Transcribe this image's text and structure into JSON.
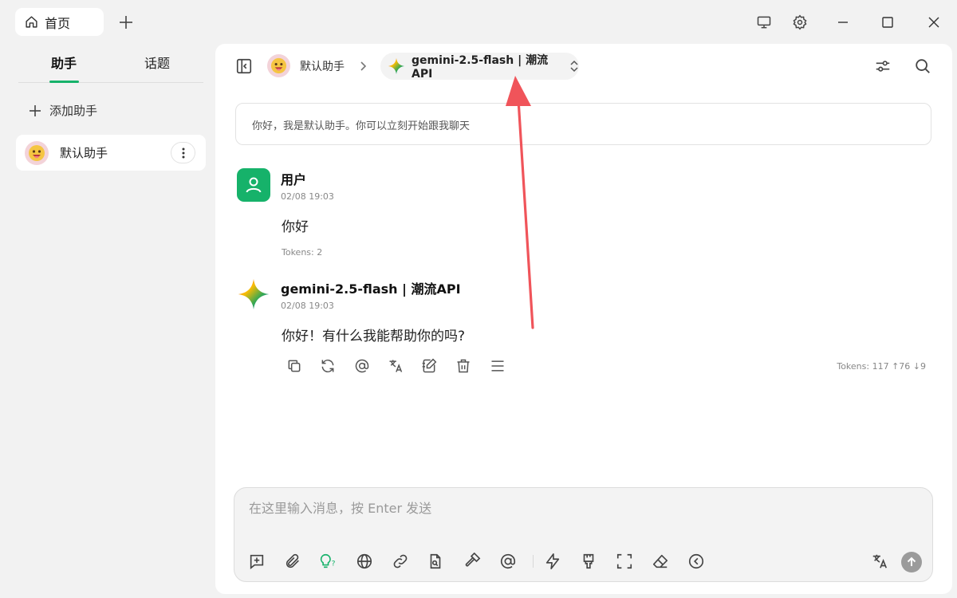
{
  "titlebar": {
    "home_tab_label": "首页"
  },
  "sidebar": {
    "tabs": [
      {
        "label": "助手",
        "active": true
      },
      {
        "label": "话题",
        "active": false
      }
    ],
    "add_assistant_label": "添加助手",
    "assistants": [
      {
        "name": "默认助手"
      }
    ]
  },
  "header": {
    "assistant_name": "默认助手",
    "model_label": "gemini-2.5-flash | 潮流API"
  },
  "welcome_text": "你好，我是默认助手。你可以立刻开始跟我聊天",
  "messages": [
    {
      "sender": "用户",
      "time": "02/08 19:03",
      "text": "你好",
      "tokens": "Tokens: 2"
    },
    {
      "sender": "gemini-2.5-flash | 潮流API",
      "time": "02/08 19:03",
      "text": "你好！有什么我能帮助你的吗?",
      "tokens": "Tokens: 117 ↑76 ↓9"
    }
  ],
  "composer": {
    "placeholder": "在这里输入消息，按 Enter 发送"
  },
  "colors": {
    "accent": "#16b26a",
    "user_avatar": "#16b26a",
    "annotation_arrow": "#f0545a"
  }
}
